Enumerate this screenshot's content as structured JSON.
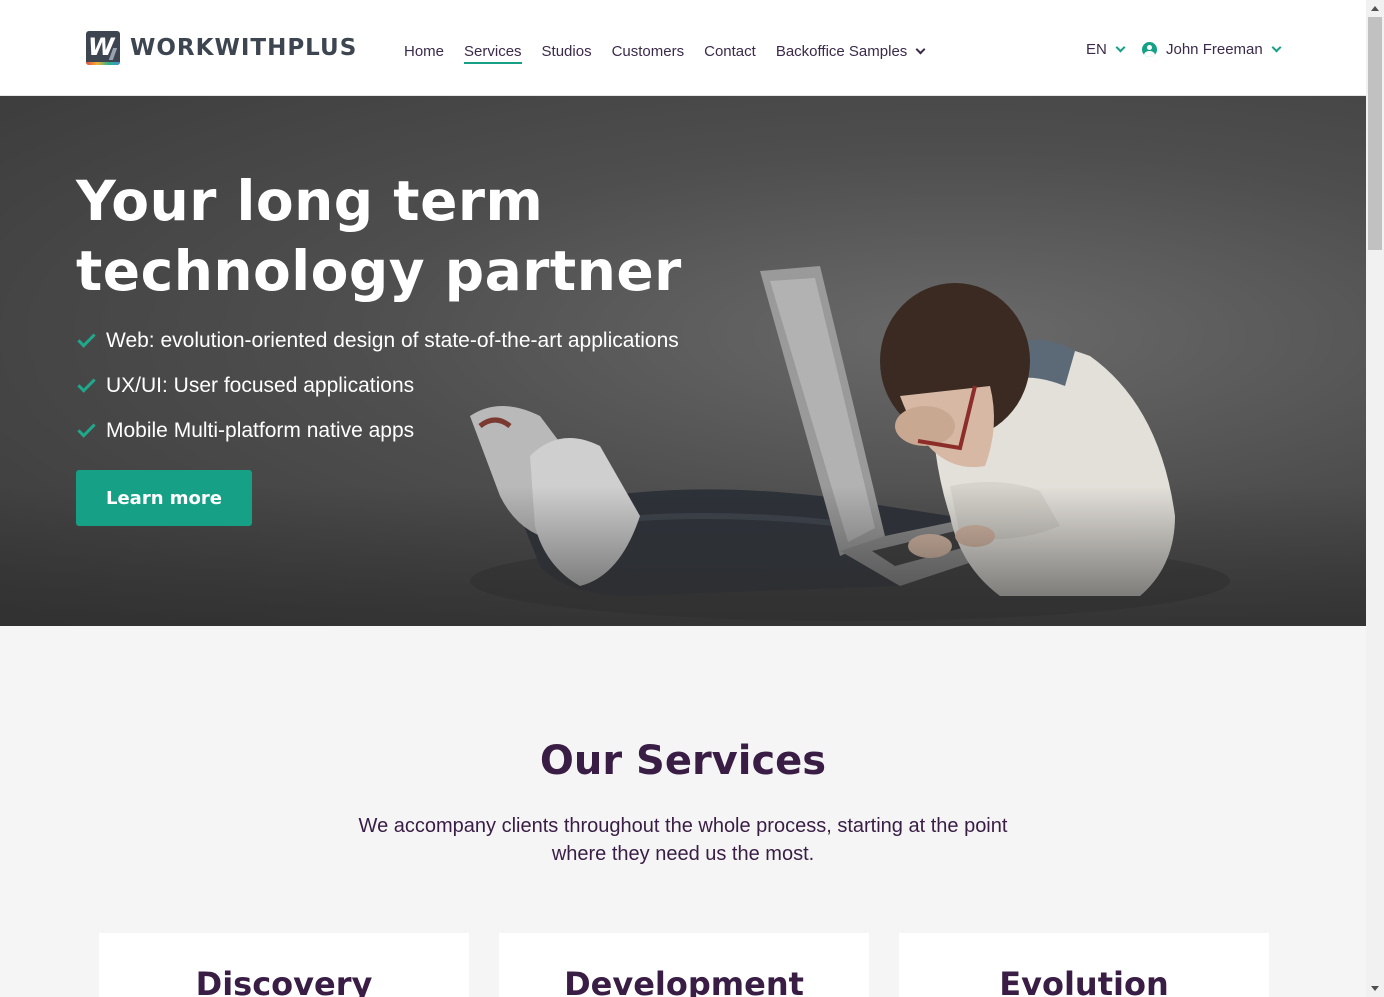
{
  "brand": {
    "name": "WORKWITHPLUS",
    "mark": "W"
  },
  "nav": {
    "items": [
      {
        "label": "Home"
      },
      {
        "label": "Services"
      },
      {
        "label": "Studios"
      },
      {
        "label": "Customers"
      },
      {
        "label": "Contact"
      },
      {
        "label": "Backoffice Samples"
      }
    ],
    "active": "Services"
  },
  "header_right": {
    "language": "EN",
    "user_name": "John Freeman"
  },
  "hero": {
    "title_line1": "Your long term",
    "title_line2": "technology partner",
    "bullets": [
      "Web: evolution-oriented design of state-of-the-art applications",
      "UX/UI: User focused applications",
      "Mobile Multi-platform native apps"
    ],
    "cta_label": "Learn more"
  },
  "services": {
    "title": "Our Services",
    "subtitle": "We accompany clients throughout the whole process, starting at the point where they need us the most.",
    "cards": [
      {
        "title": "Discovery"
      },
      {
        "title": "Development"
      },
      {
        "title": "Evolution"
      }
    ]
  },
  "colors": {
    "accent": "#16a085",
    "heading": "#3a1d45",
    "nav_text": "#3b2a4a",
    "logo": "#3d4650"
  }
}
